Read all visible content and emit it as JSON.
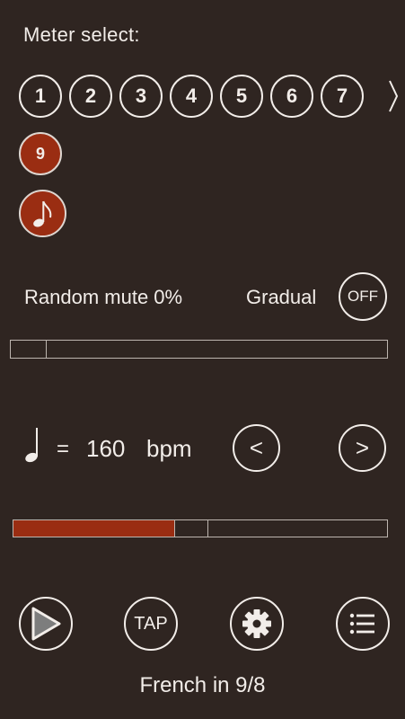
{
  "header": {
    "title": "Meter select:"
  },
  "meters": {
    "items": [
      "1",
      "2",
      "3",
      "4",
      "5",
      "6",
      "7"
    ],
    "more_icon": "chevron-right-icon",
    "selected_value": "9",
    "note_icon": "eighth-note-icon"
  },
  "random_mute": {
    "label": "Random mute 0%",
    "value_percent": 0,
    "gradual_label": "Gradual",
    "gradual_toggle": "OFF"
  },
  "tempo": {
    "note_icon": "quarter-note-icon",
    "equals": "=",
    "bpm": "160",
    "unit": "bpm",
    "prev_label": "<",
    "next_label": ">",
    "level_fraction": 0.47
  },
  "controls": {
    "play_icon": "play-icon",
    "tap_label": "TAP",
    "settings_icon": "gear-icon",
    "menu_icon": "list-icon"
  },
  "footer": {
    "status": "French in 9/8"
  },
  "colors": {
    "accent": "#9a2d12",
    "background": "#2f2521",
    "foreground": "#f2ede9"
  }
}
